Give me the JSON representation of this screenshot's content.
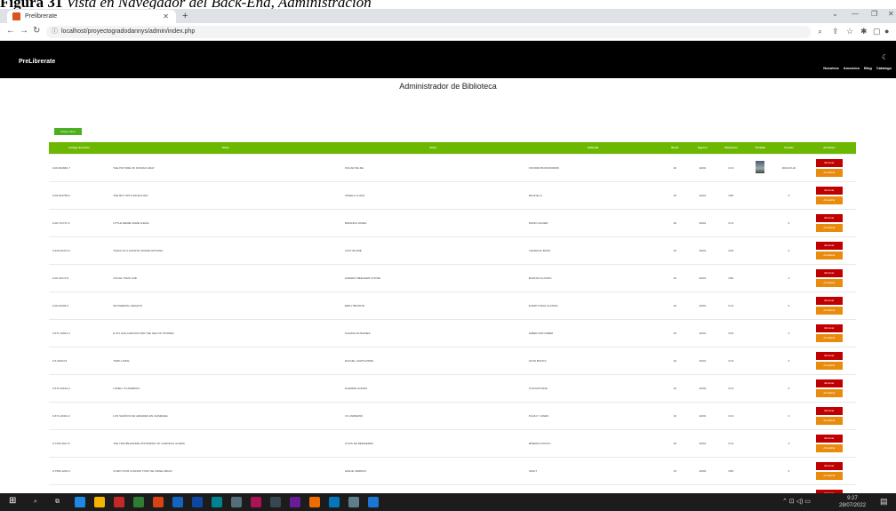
{
  "caption": {
    "label": "Figura 31",
    "text": " Vista en Navegador del Back-End, Administración"
  },
  "browser": {
    "tab_title": "Prelibrerate",
    "url": "localhost/proyectogradodannys/admin/index.php"
  },
  "site": {
    "brand": "PreLibrerate",
    "nav": [
      "Nosotros",
      "Anuncios",
      "Blog",
      "Catalogo"
    ]
  },
  "page_title": "Administrador de Biblioteca",
  "new_button": "Nuevo Libro",
  "columns": [
    "Codigo del Libro",
    "Titulo",
    "Autor",
    "Editorial",
    "Stock",
    "Ingreso",
    "Ubicacion",
    "Portada",
    "Creado",
    "Acciones"
  ],
  "actions": {
    "delete": "Eliminar",
    "update": "Actualizar"
  },
  "rows": [
    {
      "code": "0-00-824682-7",
      "title": "THE PICTURE OF DORIAN GRAY",
      "author": "OSCAR WILDE",
      "publisher": "OXFORD BOOKWORMS",
      "stock": "20",
      "entry": "11001",
      "loc": "CC3",
      "cover": true,
      "created": "2022-06-22"
    },
    {
      "code": "0-00-624758-0",
      "title": "THE BOY WITH BLUE EYES",
      "author": "ANGELA LUJAN",
      "publisher": "MAGNILLA",
      "stock": "20",
      "entry": "11001",
      "loc": "CB3",
      "cover": false,
      "created": "0"
    },
    {
      "code": "0-00-711737-4",
      "title": "LITTLE DEMIE NAME ILSDAL",
      "author": "MIRANDA JONES",
      "publisher": "DAVID CALVER",
      "stock": "20",
      "entry": "11001",
      "loc": "CC1",
      "cover": false,
      "created": "0"
    },
    {
      "code": "0-440-40474-3",
      "title": "TALES OF A FOURTH GRADE NOTHING",
      "author": "JUDY BLUME",
      "publisher": "YEARLING BOOK",
      "stock": "20",
      "entry": "11001",
      "loc": "CD4",
      "cover": false,
      "created": "0"
    },
    {
      "code": "0-00-41274-8",
      "title": "UNCLE TOMS CAB",
      "author": "HARRIET BEECHER STOWE",
      "publisher": "BANTAM CLASSIC",
      "stock": "20",
      "entry": "11001",
      "loc": "CB3",
      "cover": false,
      "created": "0"
    },
    {
      "code": "0-00-61299-3",
      "title": "WUTHERING HEIGHTS",
      "author": "EMILY BRONTE",
      "publisher": "EVERYTHING CLASSIC",
      "stock": "20",
      "entry": "11001",
      "loc": "CC2",
      "cover": false,
      "created": "0"
    },
    {
      "code": "0-571-19691-4",
      "title": "E 071 HAN-HAROUN AND THE SEA OF STORIES",
      "author": "SALMAN RUSHDIES",
      "publisher": "FABER AND FABER",
      "stock": "20",
      "entry": "11001",
      "loc": "CD4",
      "cover": false,
      "created": "0"
    },
    {
      "code": "0-6-00294-5",
      "title": "THRILL RIDE",
      "author": "RACHEL HAWTHORNE",
      "publisher": "AVON BOOKS",
      "stock": "20",
      "entry": "11001",
      "loc": "CC3",
      "cover": false,
      "created": "0"
    },
    {
      "code": "0-671-02162-4",
      "title": "LONELY IN AMERICA",
      "author": "GLEDDIE GORDO",
      "publisher": "TOUCHSTONE",
      "stock": "20",
      "entry": "11002",
      "loc": "CC3",
      "cover": false,
      "created": "0"
    },
    {
      "code": "0-671-02342-3",
      "title": "LOS SUEÑOS DE HENARES EN CHIMENEA",
      "author": "VC ANDREWS",
      "publisher": "PLAZA Y JANES",
      "stock": "10",
      "entry": "11001",
      "loc": "CC2",
      "cover": false,
      "created": "0"
    },
    {
      "code": "0-7332-0627-6",
      "title": "THE TROUBLESOME OFFSPRING OF CARDINAL GUZMA",
      "author": "LOUIS DE BERNIERES",
      "publisher": "MINERVA POCKO",
      "stock": "20",
      "entry": "11001",
      "loc": "CC4",
      "cover": false,
      "created": "0"
    },
    {
      "code": "0-7505-1226-3",
      "title": "COMO VIVIR CUANDO TODO SE VIENE ABAJO",
      "author": "LESLIE VERNICK",
      "publisher": "UNILIT",
      "stock": "10",
      "entry": "11002",
      "loc": "CB4",
      "cover": false,
      "created": "0"
    },
    {
      "code": "0-00-624718-3",
      "title": "THE IMPORTANCE OF BEING EARNEST",
      "author": "OSCAR WILDE",
      "publisher": "THE MODERN LIBRARY",
      "stock": "20",
      "entry": "11001",
      "loc": "CC4",
      "cover": false,
      "created": "0"
    }
  ],
  "tray": {
    "time": "9:27",
    "date": "28/07/2022"
  },
  "colors": {
    "header_green": "#6cb800",
    "delete_red": "#c00000",
    "update_orange": "#e98b0d",
    "nav_black": "#000000"
  }
}
